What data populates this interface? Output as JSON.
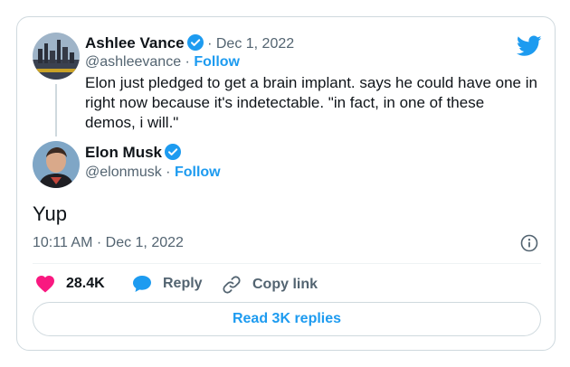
{
  "quoted": {
    "name": "Ashlee Vance",
    "sep": "·",
    "date": "Dec 1, 2022",
    "handle": "@ashleevance",
    "follow_sep": "·",
    "follow_label": "Follow",
    "text": "Elon just pledged to get a brain implant. says he could have one in right now because it's indetectable. \"in fact, in one of these demos, i will.\""
  },
  "reply": {
    "name": "Elon Musk",
    "handle": "@elonmusk",
    "follow_sep": "·",
    "follow_label": "Follow",
    "text": "Yup",
    "timestamp": "10:11 AM · Dec 1, 2022"
  },
  "actions": {
    "likes": "28.4K",
    "reply_label": "Reply",
    "copy_label": "Copy link"
  },
  "read_replies_label": "Read 3K replies",
  "colors": {
    "accent": "#1d9bf0",
    "like": "#f91880",
    "text": "#0f1419",
    "muted": "#536471"
  },
  "icons": [
    "twitter-bird-icon",
    "verified-badge-icon",
    "heart-icon",
    "reply-bubble-icon",
    "link-icon",
    "info-icon"
  ]
}
